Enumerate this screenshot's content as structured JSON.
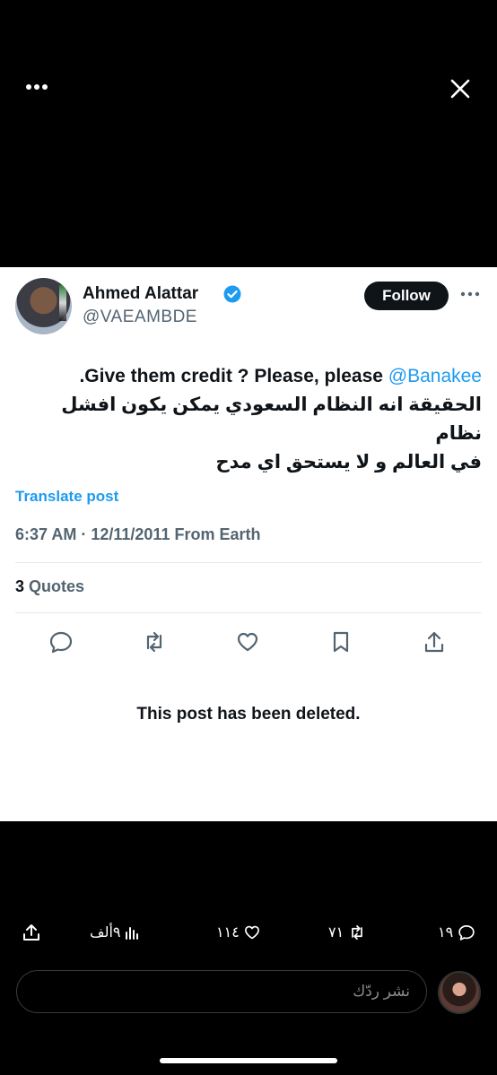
{
  "header": {
    "more_icon": "ellipsis-icon",
    "close_icon": "close-icon"
  },
  "post": {
    "author_name": "Ahmed Alattar",
    "handle": "@VAEAMBDE",
    "verified": true,
    "follow_label": "Follow",
    "text_line1_prefix": ".Give them credit ? Please, please ",
    "text_mention": "@Banakee",
    "text_arabic_1": "الحقيقة انه النظام السعودي يمكن يكون افشل نظام",
    "text_arabic_2": "في العالم و لا يستحق اي مدح",
    "translate_label": "Translate post",
    "meta": "6:37 AM · 12/11/2011 From Earth",
    "quotes_count": "3",
    "quotes_label": "Quotes",
    "deleted_notice": "This post has been deleted.",
    "accent_color": "#1d9bf0"
  },
  "bottom_bar": {
    "views": "٩ألف",
    "likes": "١١٤",
    "reposts": "٧١",
    "replies": "١٩"
  },
  "reply": {
    "placeholder": "نشر ردّك"
  }
}
